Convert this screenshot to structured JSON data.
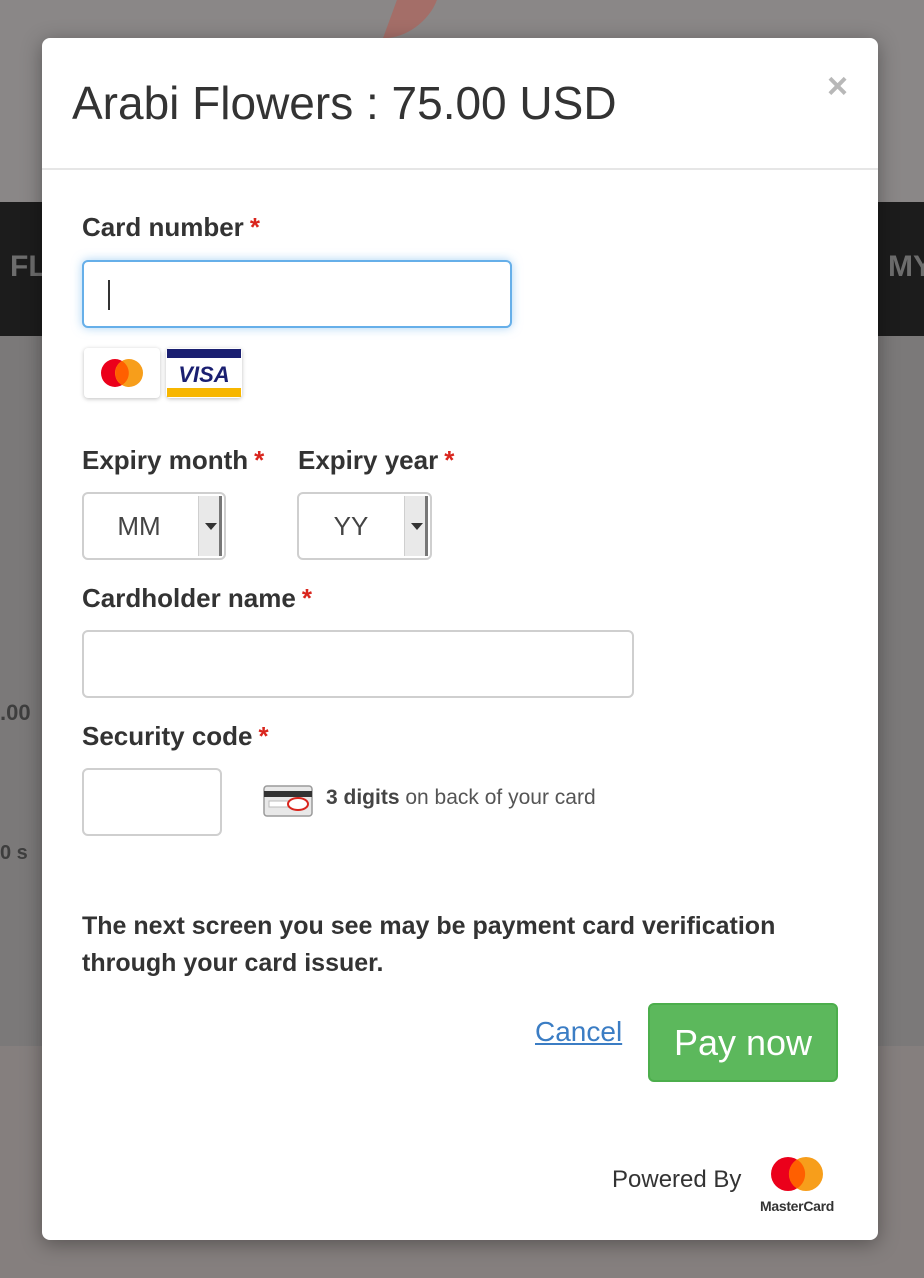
{
  "background": {
    "nav_left_fragment": "FL",
    "nav_right_fragment": "MY",
    "fragment_price": ".00",
    "fragment_small": "0 s"
  },
  "modal": {
    "title": "Arabi Flowers : 75.00 USD",
    "close_symbol": "×"
  },
  "form": {
    "card_number": {
      "label": "Card number",
      "required_mark": "*",
      "value": ""
    },
    "accepted_cards": [
      "mastercard-icon",
      "visa-icon"
    ],
    "visa_text": "VISA",
    "expiry_month": {
      "label": "Expiry month",
      "required_mark": "*",
      "selected": "MM"
    },
    "expiry_year": {
      "label": "Expiry year",
      "required_mark": "*",
      "selected": "YY"
    },
    "cardholder_name": {
      "label": "Cardholder name",
      "required_mark": "*",
      "value": ""
    },
    "security_code": {
      "label": "Security code",
      "required_mark": "*",
      "value": "",
      "hint_bold": "3 digits",
      "hint_rest": " on back of your card"
    }
  },
  "notice": "The next screen you see may be payment card verification through your card issuer.",
  "actions": {
    "cancel_label": "Cancel",
    "pay_label": "Pay now"
  },
  "footer": {
    "powered_by": "Powered By",
    "brand": "MasterCard"
  },
  "colors": {
    "required": "#d9251d",
    "pay_button": "#5cb85c",
    "link": "#3b7dc4",
    "focus_ring": "#66afe9"
  }
}
